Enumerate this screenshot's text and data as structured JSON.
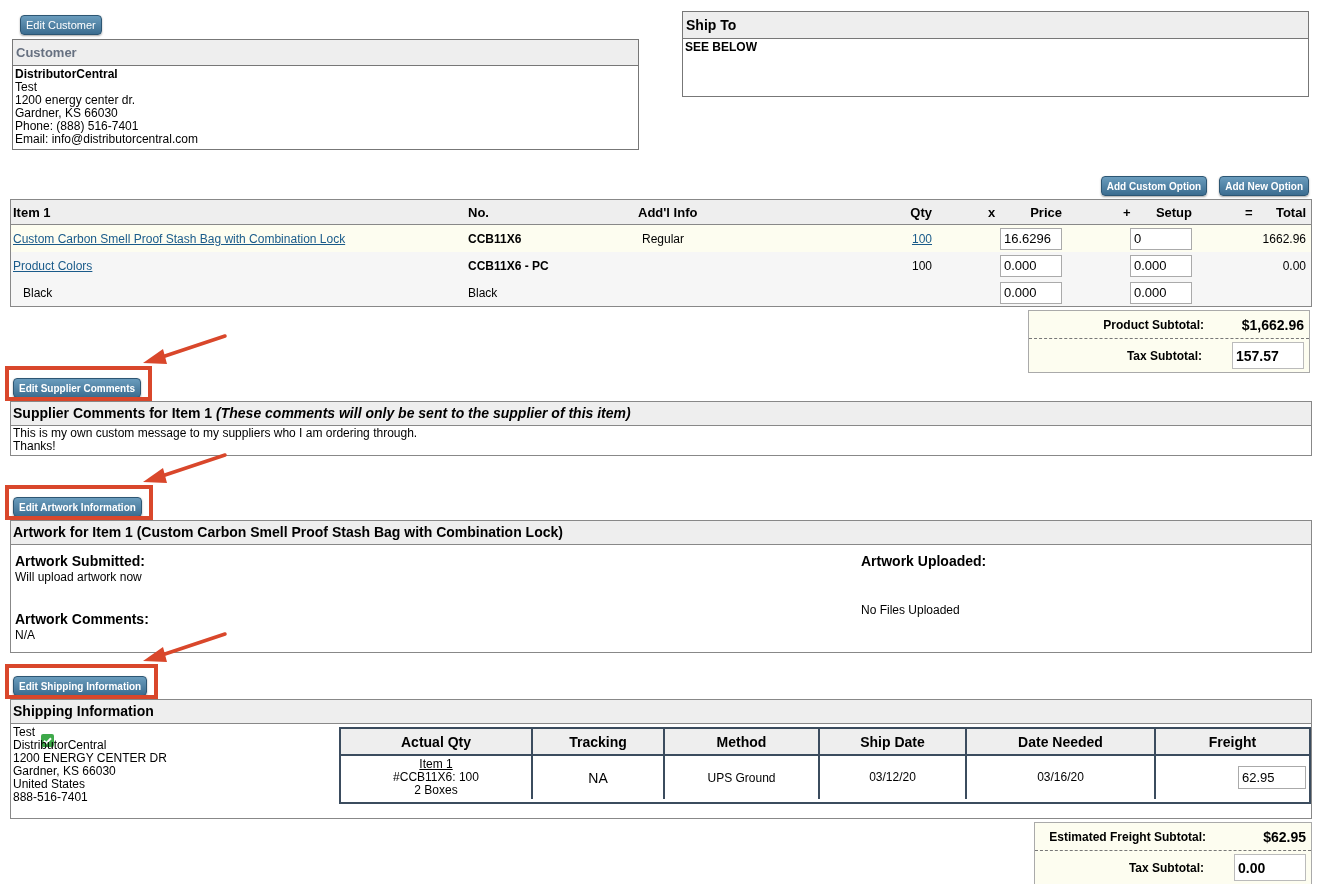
{
  "customer": {
    "edit_button": "Edit Customer",
    "title": "Customer",
    "name": "DistributorCentral",
    "lines": [
      "Test",
      "1200 energy center dr.",
      "Gardner,  KS  66030",
      "Phone: (888) 516-7401",
      "Email: info@distributorcentral.com"
    ]
  },
  "ship_to": {
    "title": "Ship To",
    "text": "SEE BELOW"
  },
  "option_buttons": [
    "Add Custom Option",
    "Add New Option"
  ],
  "items_table": {
    "columns": [
      {
        "label": "Item 1"
      },
      {
        "label": "No."
      },
      {
        "label": "Add'l Info"
      },
      {
        "label": "Qty"
      },
      {
        "label": "Price",
        "op": "x"
      },
      {
        "label": "Setup",
        "op": "+"
      },
      {
        "label": "Total",
        "op": "="
      }
    ],
    "rows": [
      {
        "kind": "item",
        "name": "Custom Carbon Smell Proof Stash Bag with Combination Lock",
        "name_link": true,
        "no": "CCB11X6",
        "info": "Regular",
        "qty": "100",
        "qty_link": true,
        "price": "16.6296",
        "setup": "0",
        "total": "1662.96"
      },
      {
        "kind": "option",
        "name": "Product Colors",
        "name_link": true,
        "no": "CCB11X6 - PC",
        "qty": "100",
        "qty_link": false,
        "price": "0.000",
        "setup": "0.000",
        "total": "0.00"
      },
      {
        "kind": "choice",
        "name": "Black",
        "name_link": false,
        "no": "Black",
        "price": "0.000",
        "setup": "0.000"
      }
    ]
  },
  "product_totals": [
    {
      "label": "Product Subtotal:",
      "value": "$1,662.96",
      "kind": "text"
    },
    {
      "label": "Tax Subtotal:",
      "value": "157.57",
      "kind": "input"
    }
  ],
  "supplier_comments": {
    "button": "Edit Supplier Comments",
    "highlighted": true,
    "title": "Supplier Comments for Item 1 ",
    "title_note": "(These comments will only be sent to the supplier of this item)",
    "lines": [
      "This is my own custom message to my suppliers who I am ordering through.",
      "Thanks!"
    ]
  },
  "artwork": {
    "button": "Edit Artwork Information",
    "highlighted": true,
    "title": "Artwork for Item 1 (Custom Carbon Smell Proof Stash Bag with Combination Lock)",
    "submitted_label": "Artwork Submitted:",
    "submitted": "Will upload artwork now",
    "comments_label": "Artwork Comments:",
    "comments": "N/A",
    "uploaded_label": "Artwork Uploaded:",
    "uploaded": "No Files Uploaded"
  },
  "shipping": {
    "button": "Edit Shipping Information",
    "highlighted": true,
    "title": "Shipping Information",
    "address_first": "Test",
    "address_checked": true,
    "address_lines": [
      "DistributorCentral",
      "1200 ENERGY CENTER DR",
      "Gardner,  KS  66030",
      "United States",
      "888-516-7401"
    ],
    "columns": [
      "Actual Qty",
      "Tracking",
      "Method",
      "Ship Date",
      "Date Needed",
      "Freight"
    ],
    "row": {
      "item_link": "Item 1",
      "qty_lines": [
        "#CCB11X6: 100",
        "2 Boxes"
      ],
      "tracking": "NA",
      "method": "UPS Ground",
      "ship_date": "03/12/20",
      "date_needed": "03/16/20",
      "freight": "62.95"
    }
  },
  "freight_totals": [
    {
      "label": "Estimated Freight Subtotal:",
      "value": "$62.95",
      "kind": "text"
    },
    {
      "label": "Tax Subtotal:",
      "value": "0.00",
      "kind": "input"
    }
  ]
}
